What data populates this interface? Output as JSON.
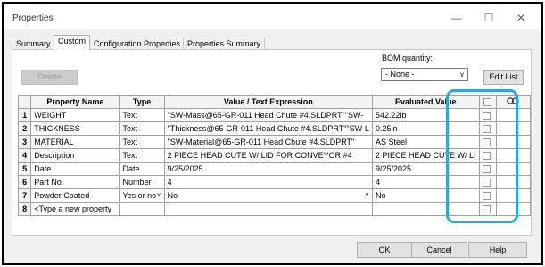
{
  "window": {
    "title": "Properties"
  },
  "tabs": [
    "Summary",
    "Custom",
    "Configuration Properties",
    "Properties Summary"
  ],
  "toolbar": {
    "delete_label": "Delete",
    "bom_quantity_label": "BOM quantity:",
    "bom_quantity_value": "- None -",
    "edit_list_label": "Edit List"
  },
  "table": {
    "headers": {
      "property_name": "Property Name",
      "type": "Type",
      "value": "Value / Text Expression",
      "evaluated": "Evaluated Value"
    },
    "rows": [
      {
        "num": "1",
        "name": "WEIGHT",
        "type": "Text",
        "value": "\"SW-Mass@65-GR-011 Head Chute #4.SLDPRT\"\"SW-",
        "evaluated": "542.22lb"
      },
      {
        "num": "2",
        "name": "THICKNESS",
        "type": "Text",
        "value": "\"Thickness@65-GR-011 Head Chute #4.SLDPRT\"\"SW-L",
        "evaluated": "0.25in"
      },
      {
        "num": "3",
        "name": "MATERIAL",
        "type": "Text",
        "value": "\"SW-Material@65-GR-011 Head Chute #4.SLDPRT\"",
        "evaluated": "AS Steel"
      },
      {
        "num": "4",
        "name": "Description",
        "type": "Text",
        "value": "2 PIECE HEAD CUTE W/ LID FOR CONVEYOR #4",
        "evaluated": "2 PIECE HEAD CUTE W/ LI"
      },
      {
        "num": "5",
        "name": "Date",
        "type": "Date",
        "value": "9/25/2025",
        "evaluated": "9/25/2025"
      },
      {
        "num": "6",
        "name": "Part No.",
        "type": "Number",
        "value": "4",
        "evaluated": "4"
      },
      {
        "num": "7",
        "name": "Powder Coated",
        "type": "Yes or no",
        "value": "No",
        "evaluated": "No"
      },
      {
        "num": "8",
        "name": "<Type a new property",
        "type": "",
        "value": "",
        "evaluated": ""
      }
    ]
  },
  "footer": {
    "ok_label": "OK",
    "cancel_label": "Cancel",
    "help_label": "Help"
  },
  "colors": {
    "highlight": "#29a8dc"
  },
  "icons": {
    "link": "link-icon",
    "minimize": "minimize-icon",
    "maximize": "maximize-icon",
    "close": "close-icon"
  }
}
